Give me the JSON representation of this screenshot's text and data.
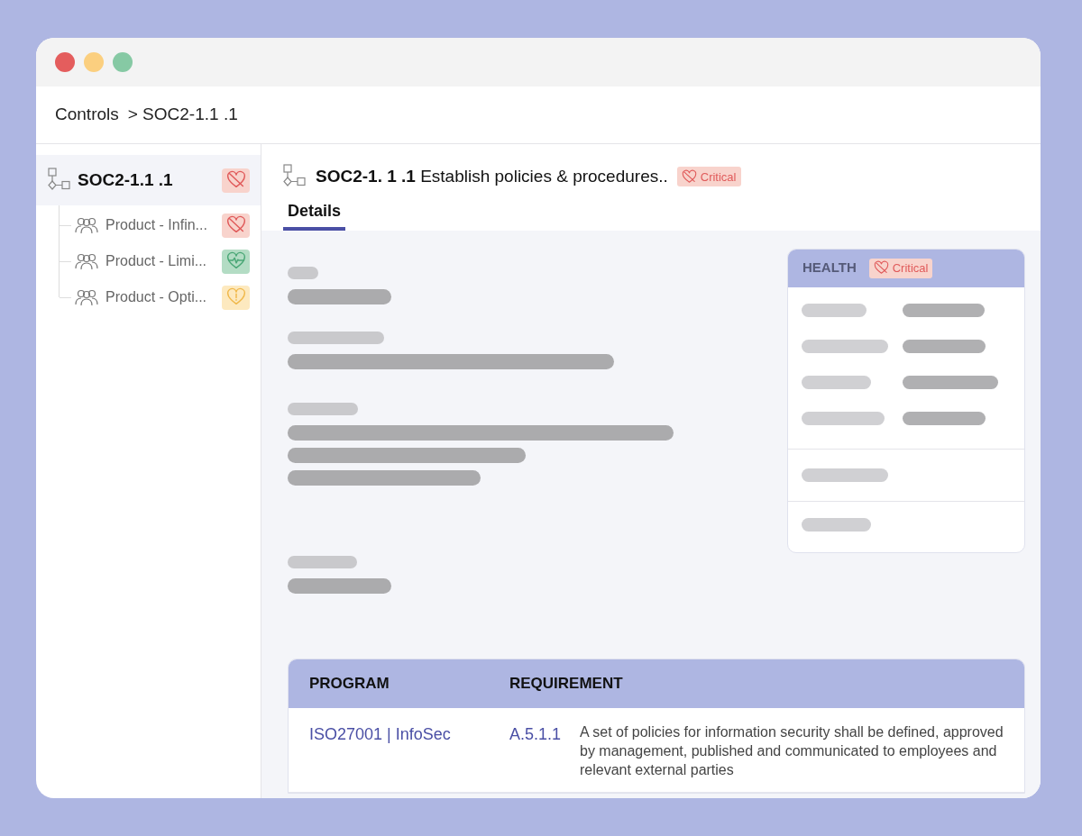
{
  "breadcrumb": [
    "Controls",
    "> SOC2-1.1 .1"
  ],
  "sidebar": {
    "items": [
      {
        "label": "SOC2-1.1 .1",
        "kind": "critical",
        "selected": true,
        "children": [
          {
            "label": "Product - Infin...",
            "kind": "critical",
            "selected": false
          },
          {
            "label": "Product - Limi...",
            "kind": "healthy",
            "selected": false
          },
          {
            "label": "Product - Opti...",
            "kind": "warning",
            "selected": false
          }
        ]
      }
    ]
  },
  "header": {
    "title": "**SOC2-1. 1 .1** Establish policies & procedures..",
    "badge": {
      "kind": "critical",
      "label": "Critical"
    }
  },
  "tabs": [
    {
      "label": "Details",
      "selected": true
    }
  ],
  "health": {
    "title": "HEALTH",
    "badge": {
      "kind": "critical",
      "label": "Critical"
    }
  },
  "table": {
    "columns": [
      "PROGRAM",
      "REQUIREMENT"
    ],
    "rows": [
      {
        "program": "ISO27001 | InfoSec",
        "requirement_id": "A.5.1.1",
        "requirement": "A set of policies for information security shall be defined, approved by management, published and communicated to employees and relevant external parties"
      }
    ]
  }
}
